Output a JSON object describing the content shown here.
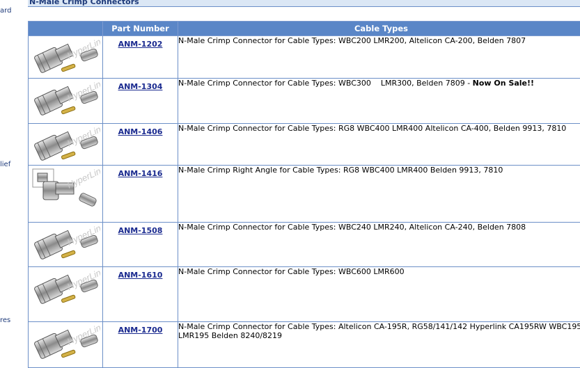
{
  "left_nav": {
    "items": [
      "ard",
      "lief",
      "res"
    ]
  },
  "section_title": "N-Male Crimp Connectors",
  "table": {
    "headers": [
      "",
      "Part Number",
      "Cable Types"
    ],
    "rows": [
      {
        "part": "ANM-1202",
        "desc": "N-Male Crimp Connector for Cable Types: WBC200 LMR200, Altelicon CA-200, Belden 7807",
        "sale": ""
      },
      {
        "part": "ANM-1304",
        "desc": "N-Male Crimp Connector for Cable Types: WBC300    LMR300, Belden 7809 - ",
        "sale": "Now On Sale!!"
      },
      {
        "part": "ANM-1406",
        "desc": "N-Male Crimp Connector for Cable Types: RG8 WBC400 LMR400 Altelicon CA-400, Belden 9913, 7810",
        "sale": ""
      },
      {
        "part": "ANM-1416",
        "desc": "N-Male Crimp Right Angle for Cable Types: RG8 WBC400 LMR400 Belden 9913, 7810",
        "sale": ""
      },
      {
        "part": "ANM-1508",
        "desc": "N-Male Crimp Connector for Cable Types: WBC240 LMR240, Altelicon CA-240, Belden 7808",
        "sale": ""
      },
      {
        "part": "ANM-1610",
        "desc": "N-Male Crimp Connector for Cable Types: WBC600 LMR600",
        "sale": ""
      },
      {
        "part": "ANM-1700",
        "desc": "N-Male Crimp Connector for Cable Types: Altelicon CA-195R, RG58/141/142 Hyperlink CA195RW WBC195 LMR195 Belden 8240/8219",
        "sale": ""
      }
    ]
  },
  "image_watermark": "HyperLink",
  "colors": {
    "header_bg": "#5a86c7",
    "border": "#6b8fc7",
    "link": "#1a2a8f",
    "title_bg": "#dbe7f5"
  }
}
